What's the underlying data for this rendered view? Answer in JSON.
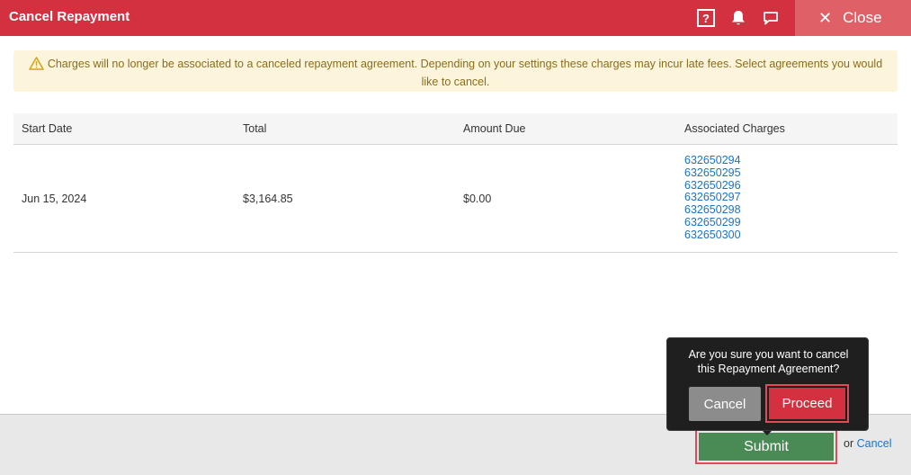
{
  "header": {
    "title": "Cancel Repayment",
    "help_glyph": "?",
    "close_label": "Close",
    "icons": [
      "help-icon",
      "bell-icon",
      "chat-icon",
      "close-icon"
    ]
  },
  "warning": {
    "text": "Charges will no longer be associated to a canceled repayment agreement. Depending on your settings these charges may incur late fees. Select agreements you would like to cancel.",
    "icon": "warning-triangle-icon",
    "color": "#8a6d1b"
  },
  "table": {
    "headers": [
      "Start Date",
      "Total",
      "Amount Due",
      "Associated Charges"
    ],
    "rows": [
      {
        "start_date": "Jun 15, 2024",
        "total": "$3,164.85",
        "amount_due": "$0.00",
        "charges": [
          "632650294",
          "632650295",
          "632650296",
          "632650297",
          "632650298",
          "632650299",
          "632650300"
        ]
      }
    ]
  },
  "confirm": {
    "line1": "Are you sure you want to cancel",
    "line2": "this Repayment Agreement?",
    "cancel_label": "Cancel",
    "proceed_label": "Proceed"
  },
  "footer": {
    "submit_label": "Submit",
    "or_text": "or",
    "cancel_link": "Cancel"
  },
  "colors": {
    "header": "#d43140",
    "close_button": "#e06068",
    "submit": "#4a8a55",
    "link": "#1a73c8",
    "highlight": "#e04b55"
  }
}
